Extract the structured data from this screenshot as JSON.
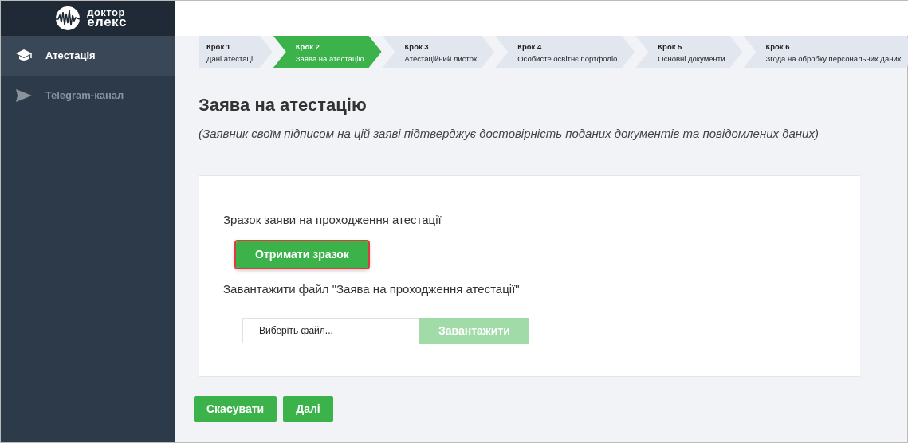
{
  "logo": {
    "line1": "доктор",
    "line2": "елекс"
  },
  "sidebar": {
    "items": [
      {
        "label": "Атестація",
        "selected": true
      },
      {
        "label": "Telegram-канал",
        "selected": false
      }
    ]
  },
  "steps": [
    {
      "number": "Крок 1",
      "label": "Дані атестації",
      "selected": false
    },
    {
      "number": "Крок 2",
      "label": "Заява на атестацію",
      "selected": true
    },
    {
      "number": "Крок 3",
      "label": "Атестаційний листок",
      "selected": false
    },
    {
      "number": "Крок 4",
      "label": "Особисте освітнє портфоліо",
      "selected": false
    },
    {
      "number": "Крок 5",
      "label": "Основні документи",
      "selected": false
    },
    {
      "number": "Крок 6",
      "label": "Згода на обробку персональних даних",
      "selected": false
    }
  ],
  "page": {
    "title": "Заява на атестацію",
    "subtitle": "(Заявник своїм підписом на цій заяві підтверджує достовірність поданих документів та повідомлених даних)"
  },
  "card": {
    "sample_label": "Зразок заяви на проходження атестації",
    "sample_button": {
      "label": "Отримати зразок",
      "highlighted": true
    },
    "upload_label": "Завантажити файл \"Заява на проходження атестації\"",
    "file_field": {
      "placeholder": "Виберіть файл..."
    },
    "upload_button": {
      "label": "Завантажити",
      "disabled": true
    }
  },
  "buttons": [
    {
      "label": "Скасувати"
    },
    {
      "label": "Далі"
    }
  ]
}
